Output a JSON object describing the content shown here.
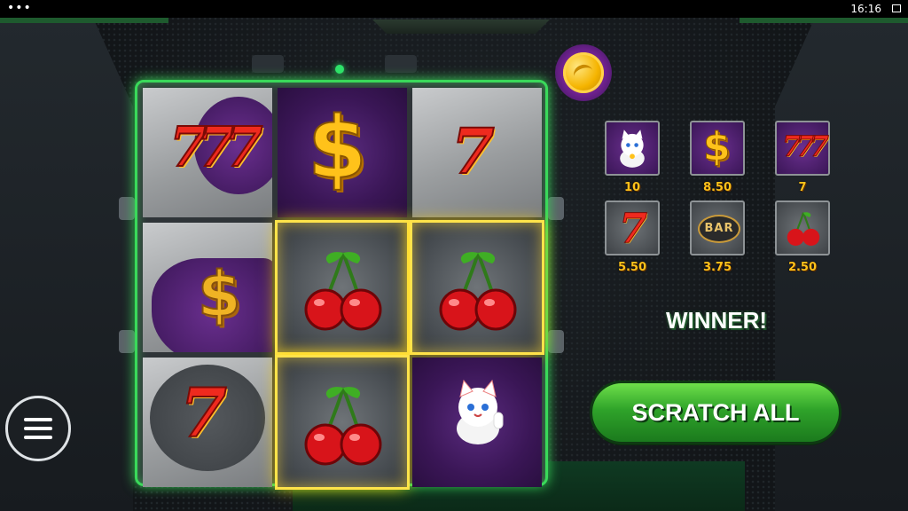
{
  "statusbar": {
    "dots": "•••",
    "time": "16:16"
  },
  "colors": {
    "grid_glow": "#3ad95a",
    "win_glow": "#ffd400",
    "button_green": "#2fa32a",
    "payout_gold": "#ffc21a"
  },
  "grid": {
    "tiles": [
      {
        "symbol": "triple-seven",
        "revealed": true,
        "win": false,
        "text": "777"
      },
      {
        "symbol": "dollar",
        "revealed": true,
        "win": false,
        "text": "$"
      },
      {
        "symbol": "seven",
        "revealed": true,
        "win": false,
        "text": "7"
      },
      {
        "symbol": "dollar",
        "revealed": false,
        "win": false,
        "text": ""
      },
      {
        "symbol": "cherry",
        "revealed": true,
        "win": true,
        "text": ""
      },
      {
        "symbol": "cherry",
        "revealed": true,
        "win": true,
        "text": ""
      },
      {
        "symbol": "seven",
        "revealed": true,
        "win": false,
        "text": "7"
      },
      {
        "symbol": "cherry",
        "revealed": true,
        "win": true,
        "text": ""
      },
      {
        "symbol": "lucky-cat",
        "revealed": true,
        "win": false,
        "text": ""
      }
    ]
  },
  "paytable": [
    {
      "symbol": "lucky-cat",
      "value": "10"
    },
    {
      "symbol": "dollar",
      "value": "8.50",
      "glyph": "$"
    },
    {
      "symbol": "triple-seven",
      "value": "7",
      "glyph": "777"
    },
    {
      "symbol": "seven",
      "value": "5.50",
      "glyph": "7"
    },
    {
      "symbol": "bar",
      "value": "3.75",
      "glyph": "BAR"
    },
    {
      "symbol": "cherry",
      "value": "2.50"
    }
  ],
  "result": {
    "winner_text": "WINNER!"
  },
  "controls": {
    "scratch_all_label": "SCRATCH ALL"
  }
}
